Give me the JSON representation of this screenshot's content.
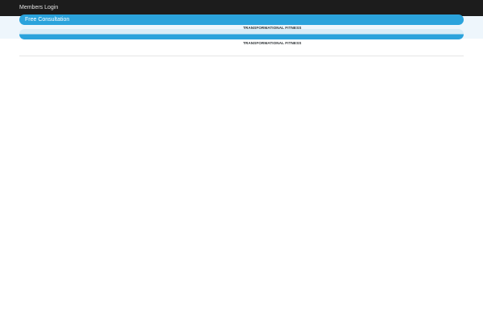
{
  "topbar": {
    "members_login": "Members Login"
  },
  "cta": {
    "primary_label": "Free Consultation",
    "secondary_label": ""
  },
  "logo": {
    "tagline": "TRANSFORMATIONAL FITNESS"
  },
  "colors": {
    "topbar": "#1c1c1c",
    "accent": "#2ba3dc",
    "header_tint": "#eef6fc"
  }
}
